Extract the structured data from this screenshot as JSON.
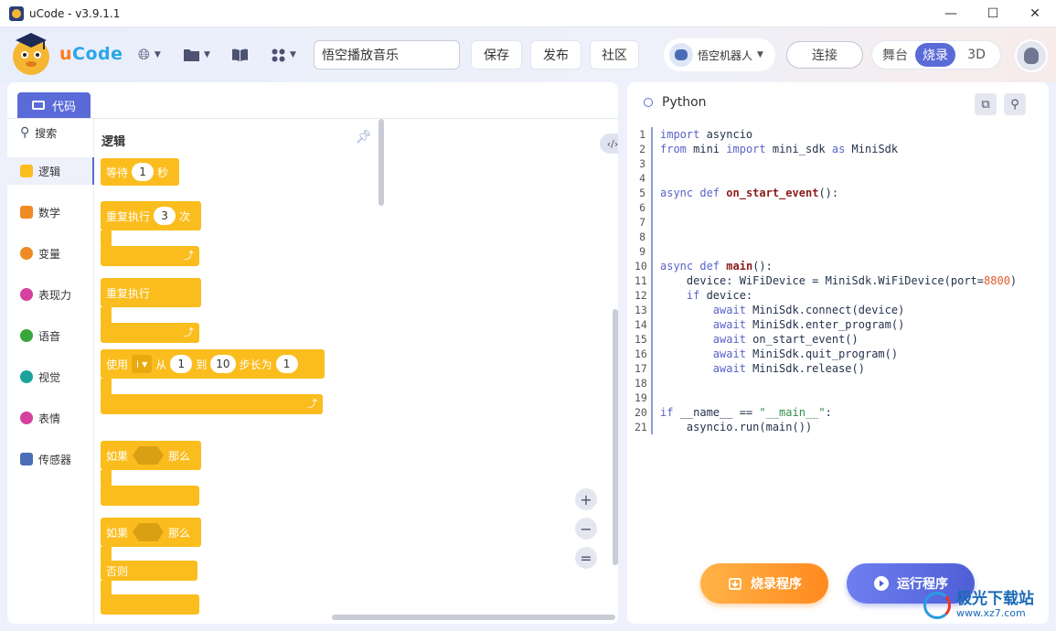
{
  "window": {
    "title": "uCode - v3.9.1.1",
    "controls": {
      "minimize": "—",
      "maximize": "☐",
      "close": "✕"
    }
  },
  "header": {
    "logo_text_a": "u",
    "logo_text_b": "Code",
    "project_name": "悟空播放音乐",
    "save_label": "保存",
    "publish_label": "发布",
    "community_label": "社区",
    "robot_label": "悟空机器人",
    "connect_label": "连接",
    "modes": [
      "舞台",
      "烧录",
      "3D"
    ],
    "active_mode": "烧录"
  },
  "left": {
    "tab_label": "代码",
    "categories": [
      {
        "label": "搜索",
        "icon": "search-icon",
        "color": "#4b5370"
      },
      {
        "label": "逻辑",
        "icon": "logic-icon",
        "color": "#fbbd1e"
      },
      {
        "label": "数学",
        "icon": "math-icon",
        "color": "#f08a24"
      },
      {
        "label": "变量",
        "icon": "variable-icon",
        "color": "#f08a24"
      },
      {
        "label": "表现力",
        "icon": "motion-icon",
        "color": "#d6409f"
      },
      {
        "label": "语音",
        "icon": "voice-icon",
        "color": "#3aa53a"
      },
      {
        "label": "视觉",
        "icon": "vision-icon",
        "color": "#1aa39a"
      },
      {
        "label": "表情",
        "icon": "expression-icon",
        "color": "#d6409f"
      },
      {
        "label": "传感器",
        "icon": "sensor-icon",
        "color": "#4b6db8"
      }
    ],
    "palette_title": "逻辑",
    "blocks": {
      "wait_label": "等待",
      "wait_value": "1",
      "wait_unit": "秒",
      "repeat_label": "重复执行",
      "repeat_value": "3",
      "repeat_unit": "次",
      "forever_label": "重复执行",
      "for_use": "使用",
      "for_var": "i",
      "for_from": "从",
      "for_from_value": "1",
      "for_to": "到",
      "for_to_value": "10",
      "for_step": "步长为",
      "for_step_value": "1",
      "if_label": "如果",
      "then_label": "那么",
      "ifelse_label": "如果",
      "ifelse_then": "那么",
      "else_label": "否则"
    },
    "zoom": {
      "in": "+",
      "out": "−",
      "reset": "="
    },
    "toggle_label": "‹/›"
  },
  "right": {
    "language": "Python",
    "code_lines": [
      "import asyncio",
      "from mini import mini_sdk as MiniSdk",
      "",
      "",
      "async def on_start_event():",
      "",
      "",
      "",
      "",
      "async def main():",
      "    device: WiFiDevice = MiniSdk.WiFiDevice(port=8800)",
      "    if device:",
      "        await MiniSdk.connect(device)",
      "        await MiniSdk.enter_program()",
      "        await on_start_event()",
      "        await MiniSdk.quit_program()",
      "        await MiniSdk.release()",
      "",
      "",
      "if __name__ == \"__main__\":",
      "    asyncio.run(main())"
    ],
    "burn_label": "烧录程序",
    "run_label": "运行程序"
  },
  "watermark": {
    "text": "极光下载站",
    "sub": "www.xz7.com"
  },
  "colors": {
    "accent": "#5a6bd8",
    "block": "#fbbd1e",
    "burn": "#ff8a1f",
    "run": "#4e5fd6"
  }
}
